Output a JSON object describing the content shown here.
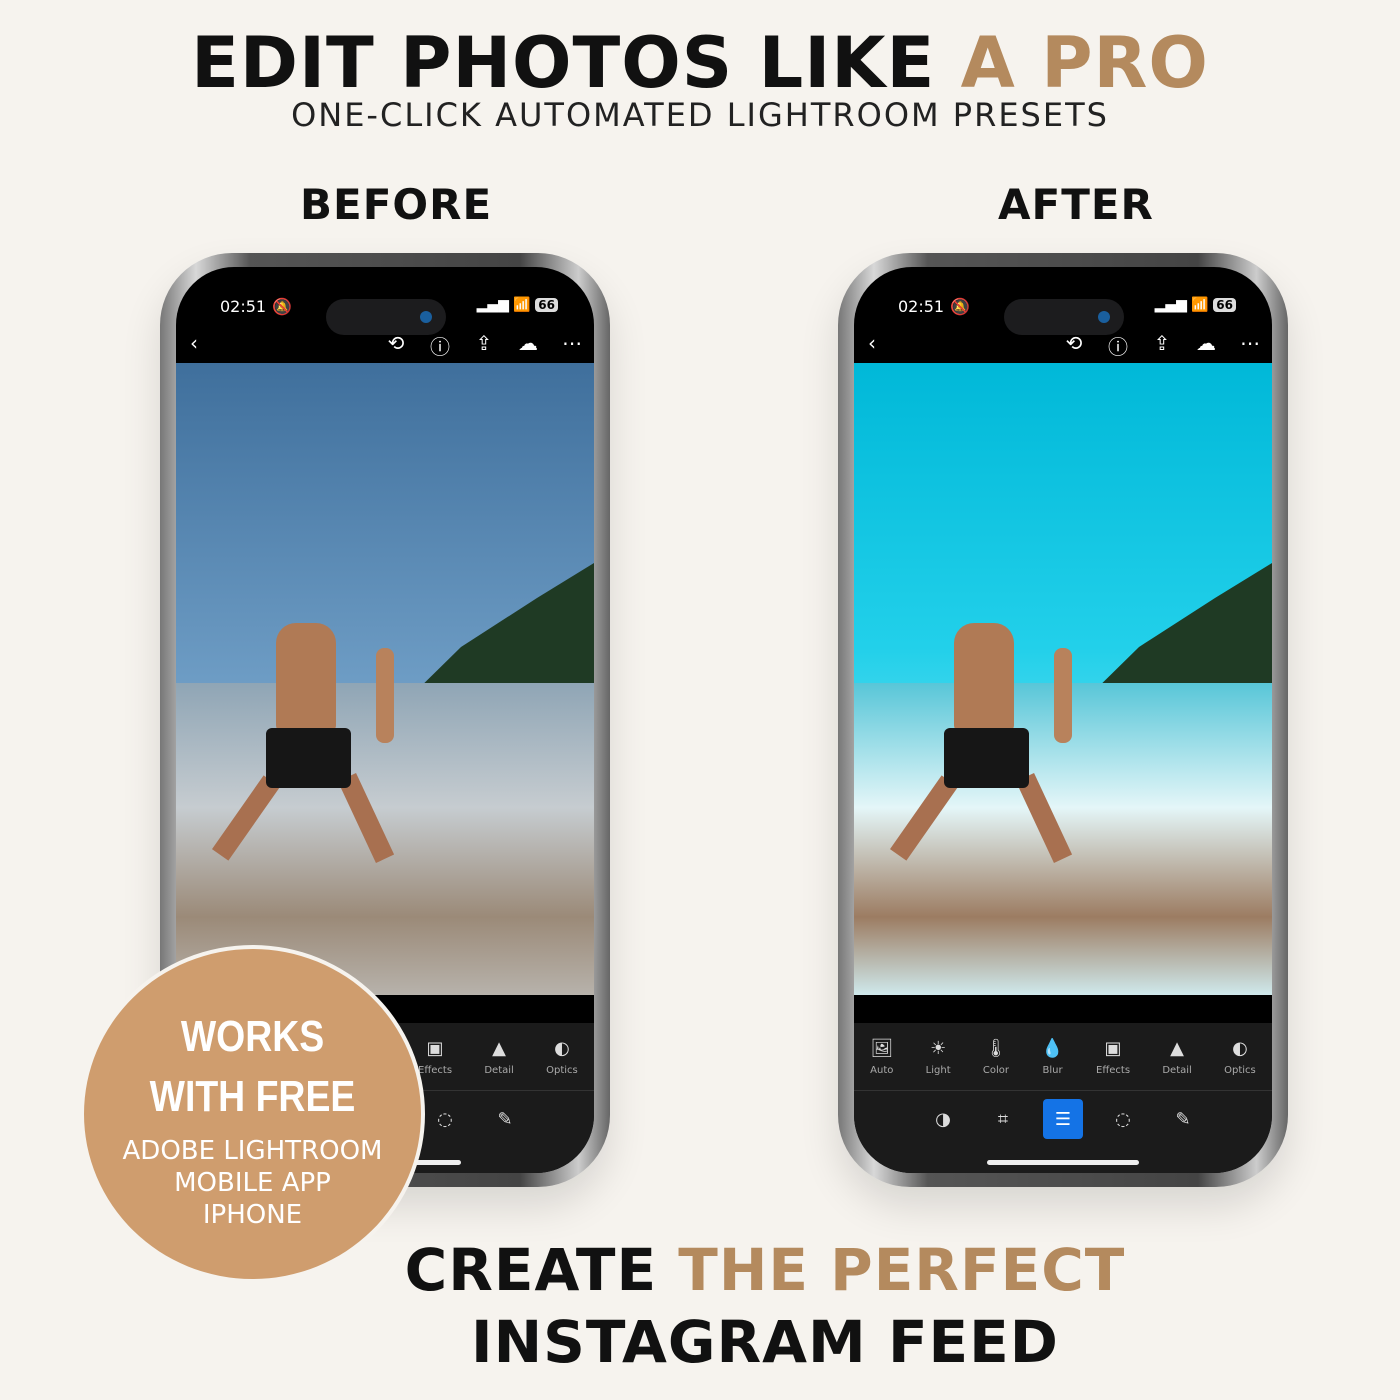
{
  "header": {
    "title_part1": "EDIT PHOTOS LIKE ",
    "title_part2": "A PRO",
    "subtitle": "ONE-CLICK AUTOMATED LIGHTROOM PRESETS"
  },
  "labels": {
    "before": "BEFORE",
    "after": "AFTER"
  },
  "phone": {
    "time": "02:51",
    "battery": "66",
    "tools": [
      "Auto",
      "Light",
      "Color",
      "Blur",
      "Effects",
      "Detail",
      "Optics"
    ]
  },
  "badge": {
    "line1": "WORKS",
    "line2": "WITH FREE",
    "line3": "ADOBE LIGHTROOM",
    "line4": "MOBILE APP",
    "line5": "IPHONE"
  },
  "footer": {
    "line1_part1": "CREATE ",
    "line1_part2": "THE PERFECT",
    "line2": "INSTAGRAM FEED"
  },
  "colors": {
    "accent": "#b48a5e",
    "badge": "#cf9d6e",
    "active_tool": "#1473e6"
  }
}
